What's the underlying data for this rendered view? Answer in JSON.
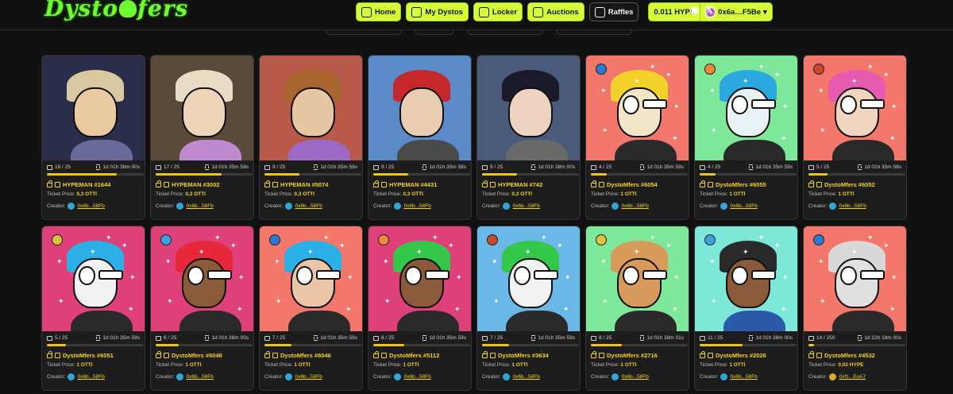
{
  "header": {
    "logo": "Dysto Mfers",
    "nav": [
      {
        "label": "Home",
        "icon": "home-icon"
      },
      {
        "label": "My Dystos",
        "icon": "grid-icon"
      },
      {
        "label": "Locker",
        "icon": "lock-icon"
      },
      {
        "label": "Auctions",
        "icon": "gavel-icon"
      },
      {
        "label": "Raffles",
        "icon": "ticket-icon"
      }
    ],
    "wallet": {
      "balance": "0.011 HYPE",
      "address": "0x6a…F5Be"
    },
    "colors": {
      "accent": "#d6ff3a",
      "logo": "#6dfc2f",
      "highlight": "#f5d315"
    }
  },
  "labels": {
    "ticket_price": "Ticket Price:",
    "creator": "Creator:"
  },
  "cards": [
    {
      "tickets": "18 / 25",
      "time": "1d 01h 38m 00s",
      "progress": 0.72,
      "name": "HYPEMAN #1644",
      "price": "0,3 OTTI",
      "creator": "0x6b...58Fb",
      "bg": "#2a2e4a",
      "skin": "#e9c9a0",
      "hair": "#d9c8a0",
      "top": "#6a6a9a"
    },
    {
      "tickets": "17 / 25",
      "time": "1d 01h 35m 59s",
      "progress": 0.68,
      "name": "HYPEMAN #3002",
      "price": "0,3 OTTI",
      "creator": "0x6b...58Fb",
      "bg": "#5a4a3a",
      "skin": "#efd5b8",
      "hair": "#e9dcc4",
      "top": "#c08ad0"
    },
    {
      "tickets": "9 / 25",
      "time": "1d 01h 35m 59s",
      "progress": 0.36,
      "name": "HYPEMAN #5074",
      "price": "0,3 OTTI",
      "creator": "0x6b...58Fb",
      "bg": "#b85a4a",
      "skin": "#e7c6a4",
      "hair": "#a8652d",
      "top": "#9a6ac4"
    },
    {
      "tickets": "9 / 25",
      "time": "1d 01h 35m 58s",
      "progress": 0.36,
      "name": "HYPEMAN #4431",
      "price": "0,3 OTTI",
      "creator": "0x6b...58Fb",
      "bg": "#5a8ac8",
      "skin": "#e9cdb3",
      "hair": "#c4282a",
      "top": "#4a4a4a"
    },
    {
      "tickets": "9 / 25",
      "time": "1d 01h 38m 00s",
      "progress": 0.36,
      "name": "HYPEMAN #742",
      "price": "0,3 OTTI",
      "creator": "0x6b...58Fb",
      "bg": "#4a5a7a",
      "skin": "#eed3c0",
      "hair": "#1a1a2a",
      "top": "#6a6a6a"
    },
    {
      "tickets": "4 / 25",
      "time": "1d 01h 35m 59s",
      "progress": 0.16,
      "name": "DystoMfers #6054",
      "price": "1 OTTI",
      "creator": "0x6b...58Fb",
      "bg": "#f4776b",
      "skin": "#f2e6c8",
      "hair": "#f2d22a",
      "top": "#2a2a2a"
    },
    {
      "tickets": "4 / 25",
      "time": "1d 01h 35m 59s",
      "progress": 0.16,
      "name": "DystoMfers #6055",
      "price": "1 OTTI",
      "creator": "0x6b...58Fb",
      "bg": "#7de89a",
      "skin": "#e9f2f4",
      "hair": "#2aa8e0",
      "top": "#2a2a2a"
    },
    {
      "tickets": "5 / 25",
      "time": "1d 01h 35m 58s",
      "progress": 0.2,
      "name": "DystoMfers #6052",
      "price": "1 OTTI",
      "creator": "0x6b...58Fb",
      "bg": "#f4776b",
      "skin": "#f0d6c0",
      "hair": "#e65ab0",
      "top": "#2a2a2a"
    },
    {
      "tickets": "5 / 25",
      "time": "1d 01h 35m 59s",
      "progress": 0.2,
      "name": "DystoMfers #6051",
      "price": "1 OTTI",
      "creator": "0x6b...58Fb",
      "bg": "#e0407a",
      "skin": "#f2f2f2",
      "hair": "#2ab0e6",
      "top": "#2a2a2a"
    },
    {
      "tickets": "6 / 25",
      "time": "1d 01h 38m 00s",
      "progress": 0.24,
      "name": "DystoMfers #6048",
      "price": "1 OTTI",
      "creator": "0x6b...58Fb",
      "bg": "#e0407a",
      "skin": "#8a5a3a",
      "hair": "#e6283a",
      "top": "#2a2a2a"
    },
    {
      "tickets": "7 / 25",
      "time": "1d 01h 35m 59s",
      "progress": 0.28,
      "name": "DystoMfers #6046",
      "price": "1 OTTI",
      "creator": "0x6b...58Fb",
      "bg": "#f4776b",
      "skin": "#e9c6a8",
      "hair": "#2ab0e6",
      "top": "#2a2a2a"
    },
    {
      "tickets": "8 / 25",
      "time": "1d 01h 35m 59s",
      "progress": 0.32,
      "name": "DystoMfers #5112",
      "price": "1 OTTI",
      "creator": "0x6b...58Fb",
      "bg": "#e0407a",
      "skin": "#8a5a3a",
      "hair": "#34c84a",
      "top": "#2a2a2a"
    },
    {
      "tickets": "7 / 25",
      "time": "1d 01h 35m 59s",
      "progress": 0.28,
      "name": "DystoMfers #3634",
      "price": "1 OTTI",
      "creator": "0x6b...58Fb",
      "bg": "#6ab8e8",
      "skin": "#f2f2f2",
      "hair": "#34c84a",
      "top": "#2a2a2a"
    },
    {
      "tickets": "8 / 25",
      "time": "1d 01h 38m 01s",
      "progress": 0.32,
      "name": "DystoMfers #2716",
      "price": "1 OTTI",
      "creator": "0x6b...58Fb",
      "bg": "#7de89a",
      "skin": "#d89a5a",
      "hair": "#d89a5a",
      "top": "#2a2a2a"
    },
    {
      "tickets": "11 / 25",
      "time": "1d 01h 38m 00s",
      "progress": 0.44,
      "name": "DystoMfers #2026",
      "price": "1 OTTI",
      "creator": "0x6b...58Fb",
      "bg": "#7de8d8",
      "skin": "#8a5a3a",
      "hair": "#2a2a2a",
      "top": "#2a5aa8"
    },
    {
      "tickets": "14 / 250",
      "time": "1d 22h 18m 00s",
      "progress": 0.056,
      "name": "DystoMfers #4532",
      "price": "0,02 HYPE",
      "creator": "0xf1...EoA7",
      "bg": "#f4776b",
      "skin": "#e0e0e0",
      "hair": "#d8d8d8",
      "top": "#2a2a2a"
    }
  ]
}
